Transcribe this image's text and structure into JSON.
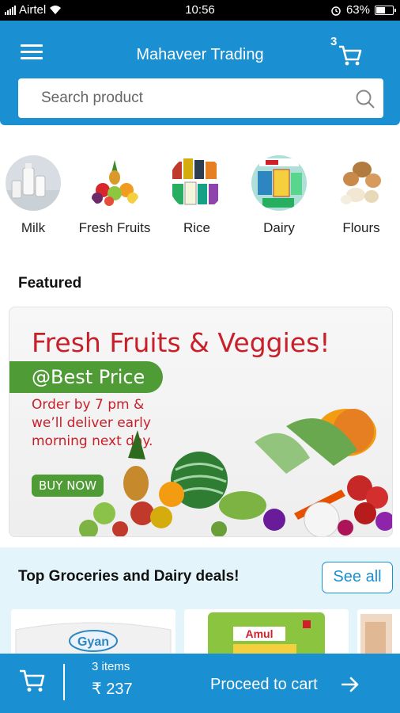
{
  "status_bar": {
    "carrier": "Airtel",
    "time": "10:56",
    "battery": "63%",
    "battery_level": 0.63
  },
  "header": {
    "title": "Mahaveer Trading",
    "cart_count": "3"
  },
  "search": {
    "placeholder": "Search product"
  },
  "categories": [
    {
      "label": "Milk",
      "icon": "milk-bottles-icon"
    },
    {
      "label": "Fresh Fruits",
      "icon": "fruit-basket-icon"
    },
    {
      "label": "Rice",
      "icon": "rice-packs-icon"
    },
    {
      "label": "Dairy",
      "icon": "dairy-products-icon"
    },
    {
      "label": "Flours",
      "icon": "flour-icon"
    }
  ],
  "featured": {
    "title": "Featured",
    "banner": {
      "headline": "Fresh Fruits & Veggies!",
      "price_tag": "@Best Price",
      "subtext": "Order by 7 pm & we’ll deliver early morning next day.",
      "button": "BUY NOW",
      "colors": {
        "headline": "#c8202a",
        "green": "#4f9b35"
      }
    }
  },
  "deals": {
    "title": "Top Groceries and Dairy deals!",
    "see_all": "See all",
    "products": [
      {
        "brand": "Gyan"
      },
      {
        "brand": "Amul"
      }
    ]
  },
  "bottom_bar": {
    "items": "3 items",
    "total": "₹ 237",
    "proceed": "Proceed to cart"
  },
  "colors": {
    "primary": "#1a8fd1",
    "deals_bg": "#e3f5fb"
  }
}
